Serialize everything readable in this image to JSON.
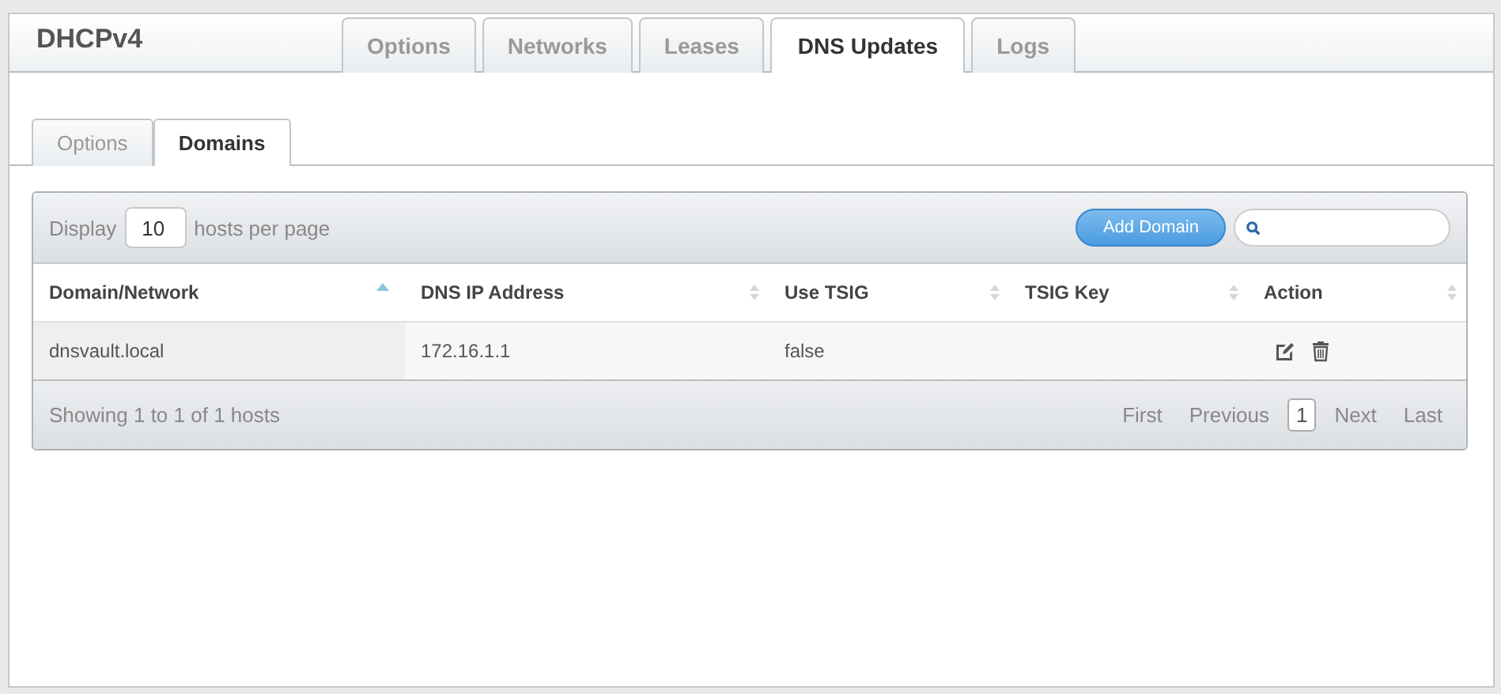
{
  "title": "DHCPv4",
  "tabs": [
    {
      "label": "Options",
      "selected": false
    },
    {
      "label": "Networks",
      "selected": false
    },
    {
      "label": "Leases",
      "selected": false
    },
    {
      "label": "DNS Updates",
      "selected": true
    },
    {
      "label": "Logs",
      "selected": false
    }
  ],
  "subtabs": [
    {
      "label": "Options",
      "selected": false
    },
    {
      "label": "Domains",
      "selected": true
    }
  ],
  "toolbar": {
    "display_label": "Display",
    "page_size": "10",
    "per_page_label": "hosts per page",
    "add_button": "Add Domain"
  },
  "table": {
    "columns": [
      {
        "label": "Domain/Network",
        "sorted": true
      },
      {
        "label": "DNS IP Address",
        "sorted": false
      },
      {
        "label": "Use TSIG",
        "sorted": false
      },
      {
        "label": "TSIG Key",
        "sorted": false
      },
      {
        "label": "Action",
        "sorted": false
      }
    ],
    "rows": [
      {
        "cells": [
          "dnsvault.local",
          "172.16.1.1",
          "false"
        ]
      }
    ]
  },
  "footer": {
    "info": "Showing 1 to 1 of 1 hosts",
    "pages": [
      {
        "label": "First",
        "selected": false
      },
      {
        "label": "Previous",
        "selected": false
      },
      {
        "label": "1",
        "selected": true
      },
      {
        "label": "Next",
        "selected": false
      },
      {
        "label": "Last",
        "selected": false
      }
    ]
  }
}
